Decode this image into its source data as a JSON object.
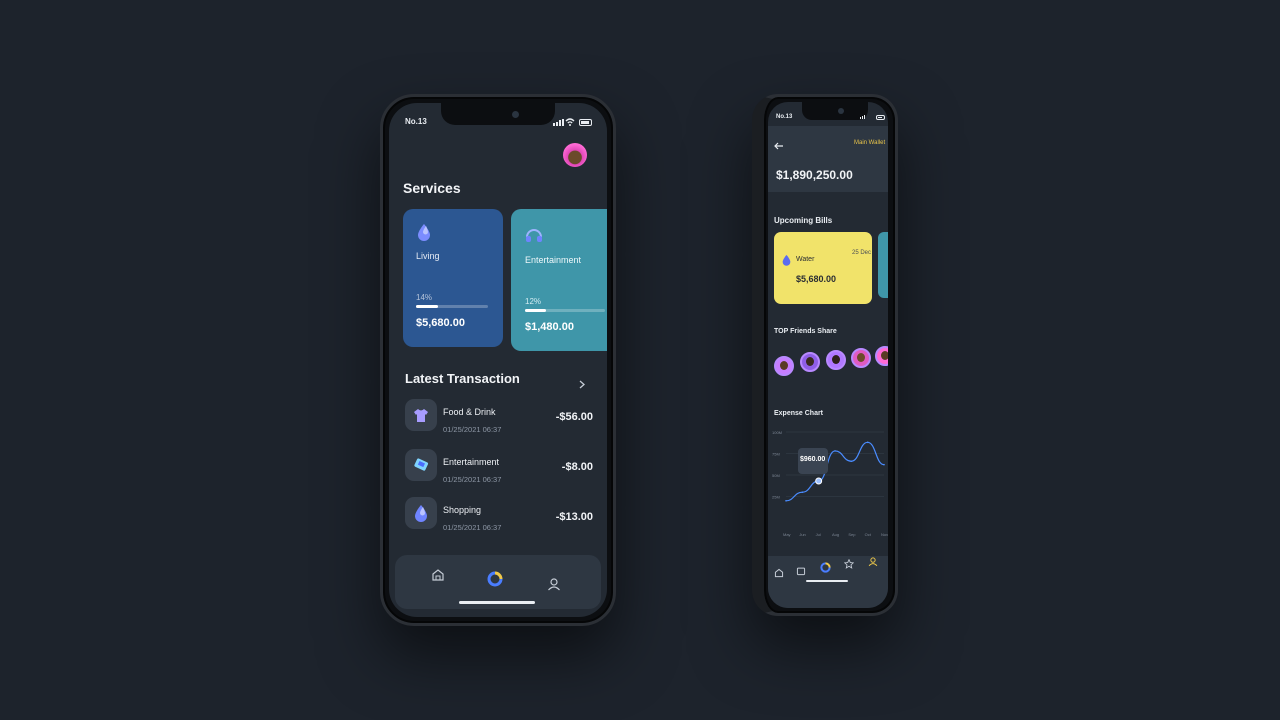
{
  "left_phone": {
    "status_time": "No.13",
    "services_title": "Services",
    "services": [
      {
        "label": "Living",
        "percent_label": "14%",
        "progress": 0.14,
        "amount": "$5,680.00",
        "color": "#2c5792",
        "icon": "droplet-icon"
      },
      {
        "label": "Entertainment",
        "percent_label": "12%",
        "progress": 0.12,
        "amount": "$1,480.00",
        "color": "#3f96a9",
        "icon": "headphones-icon"
      }
    ],
    "latest_title": "Latest Transaction",
    "transactions": [
      {
        "name": "Food & Drink",
        "date": "01/25/2021 06:37",
        "amount": "-$56.00",
        "icon": "shirt-icon"
      },
      {
        "name": "Entertainment",
        "date": "01/25/2021 06:37",
        "amount": "-$8.00",
        "icon": "ticket-icon"
      },
      {
        "name": "Shopping",
        "date": "01/25/2021 06:37",
        "amount": "-$13.00",
        "icon": "droplet-icon"
      }
    ],
    "nav": [
      "home-icon",
      "donut-chart-icon",
      "user-icon"
    ]
  },
  "right_phone": {
    "status_time": "No.13",
    "wallet_label": "Main Wallet",
    "balance": "$1,890,250.00",
    "upcoming_title": "Upcoming Bills",
    "bill": {
      "name": "Water",
      "date": "25 Dec",
      "amount": "$5,680.00",
      "color": "#f1e36a"
    },
    "friends_title": "TOP Friends Share",
    "chart_title": "Expense Chart",
    "nav": [
      "home-icon",
      "wallet-icon",
      "donut-chart-icon",
      "star-icon",
      "user-icon"
    ],
    "accent": "#e9c54a"
  },
  "chart_data": {
    "type": "line",
    "title": "Expense Chart",
    "x": [
      "May",
      "Jun",
      "Jul",
      "Aug",
      "Sep",
      "Oct",
      "Nov"
    ],
    "y_ticks": [
      "25M",
      "50M",
      "75M",
      "100M"
    ],
    "series": [
      {
        "values": [
          20,
          30,
          43,
          78,
          66,
          88,
          62
        ]
      }
    ],
    "tooltip": {
      "label": "$960.00",
      "index": 2
    },
    "ylim": [
      0,
      100
    ],
    "grid": true
  }
}
